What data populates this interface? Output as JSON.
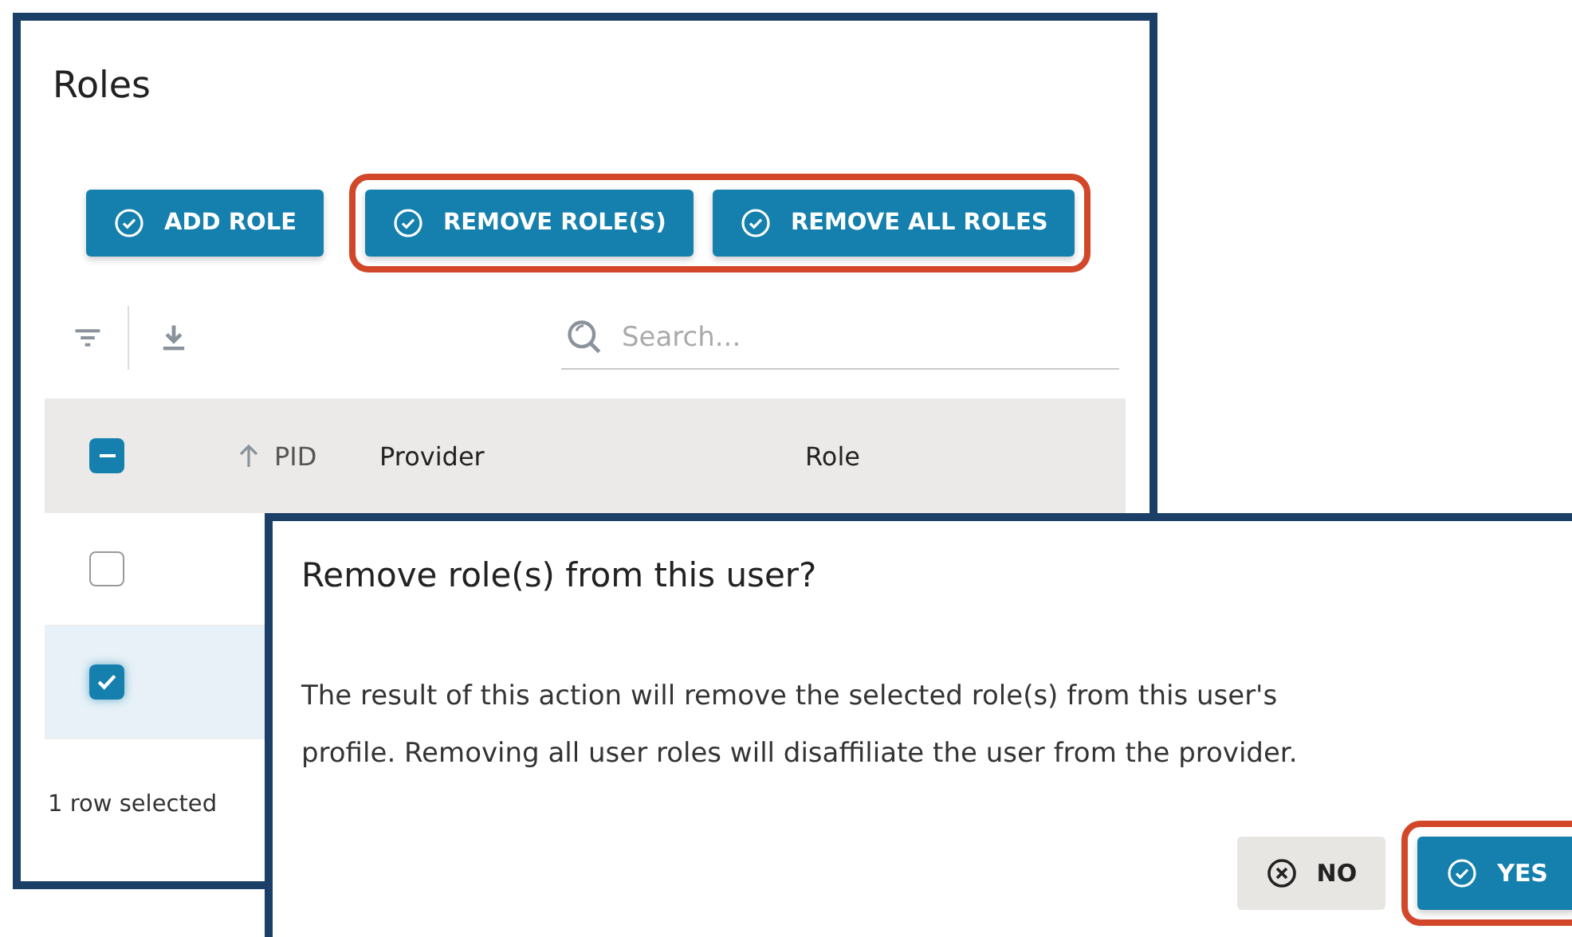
{
  "roles_panel": {
    "title": "Roles",
    "button_groups": [
      {
        "highlighted": false,
        "buttons": [
          "ADD ROLE"
        ]
      },
      {
        "highlighted": true,
        "buttons": [
          "REMOVE ROLE(S)",
          "REMOVE ALL ROLES"
        ]
      }
    ],
    "search": {
      "placeholder": "Search..."
    },
    "table": {
      "header_checkbox": {
        "indeterminate": true
      },
      "sort_ascending": true,
      "columns": [
        "PID",
        "Provider",
        "Role"
      ],
      "rows": [
        {
          "selected": false
        },
        {
          "selected": true
        }
      ]
    },
    "footer": "1 row selected"
  },
  "dialog": {
    "title": "Remove role(s) from this user?",
    "message": "The result of this action will remove the selected role(s) from this user's profile. Removing all user roles will disaffiliate the user from the provider.",
    "buttons": [
      {
        "kind": "cancel",
        "label": "NO",
        "highlighted": false
      },
      {
        "kind": "confirm",
        "label": "YES",
        "highlighted": true
      }
    ]
  }
}
